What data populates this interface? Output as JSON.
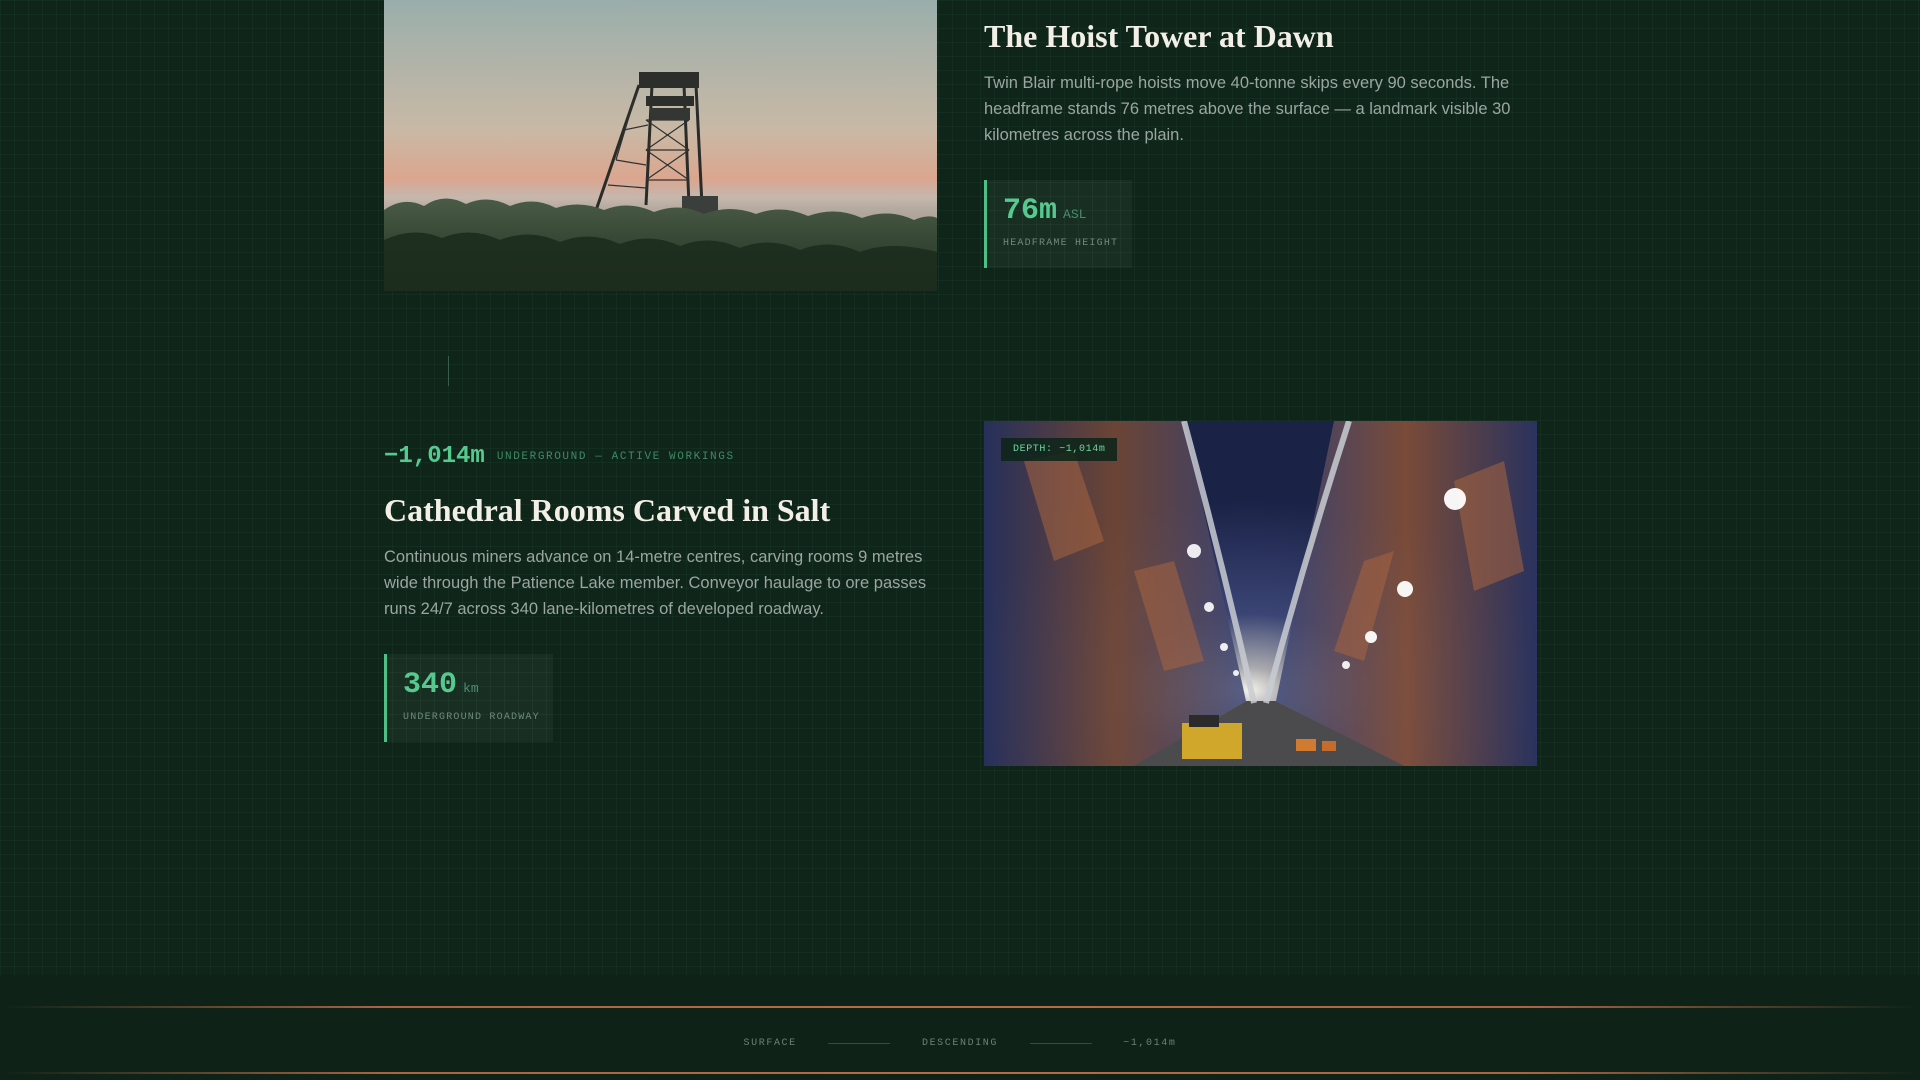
{
  "section_surface": {
    "title": "The Hoist Tower at Dawn",
    "body": "Twin Blair multi-rope hoists move 40-tonne skips every 90 seconds. The headframe stands 76 metres above the surface — a landmark visible 30 kilometres across the plain.",
    "stat": {
      "value": "76m",
      "unit": "ASL",
      "label": "HEADFRAME HEIGHT"
    }
  },
  "section_underground": {
    "depth_value": "−1,014m",
    "depth_label": "UNDERGROUND — ACTIVE WORKINGS",
    "title": "Cathedral Rooms Carved in Salt",
    "body": "Continuous miners advance on 14-metre centres, carving rooms 9 metres wide through the Patience Lake member. Conveyor haulage to ore passes runs 24/7 across 340 lane-kilometres of developed roadway.",
    "stat": {
      "value": "340",
      "unit": "km",
      "label": "UNDERGROUND ROADWAY"
    },
    "image_tag": "DEPTH: −1,014m"
  },
  "footer": {
    "nav": [
      "SURFACE",
      "DESCENDING",
      "−1,014m"
    ]
  },
  "colors": {
    "background": "#0f251a",
    "accent": "#56c98f",
    "copper": "#b96c46",
    "heading": "#f3efe6"
  },
  "icons": {
    "tower_photo": "headframe-tower-image",
    "mine_photo": "mine-tunnel-image"
  }
}
